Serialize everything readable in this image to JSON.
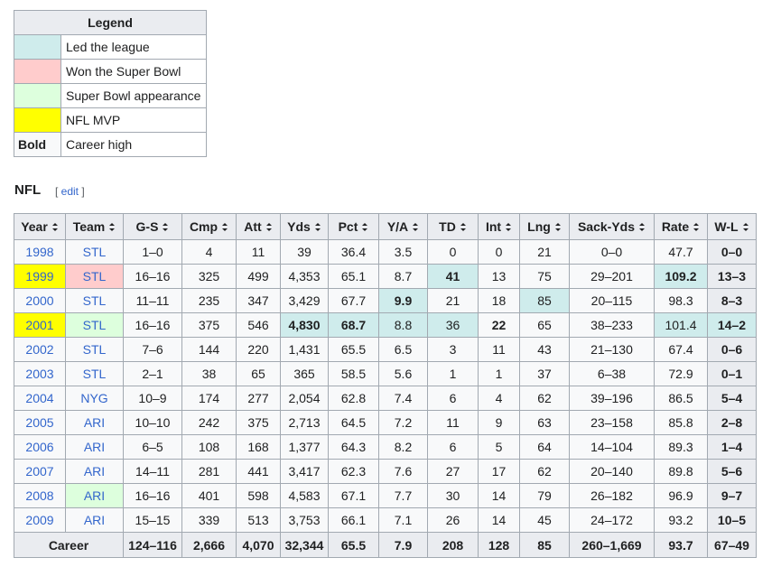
{
  "legend": {
    "title": "Legend",
    "rows": [
      {
        "key": "led",
        "color": "#cfecec",
        "label": "Led the league"
      },
      {
        "key": "won",
        "color": "#ffcccc",
        "label": "Won the Super Bowl"
      },
      {
        "key": "sb",
        "color": "#ddffdd",
        "label": "Super Bowl appearance"
      },
      {
        "key": "mvp",
        "color": "#ffff00",
        "label": "NFL MVP"
      },
      {
        "key": "bold",
        "swatch_text": "Bold",
        "label": "Career high"
      }
    ]
  },
  "section": {
    "title": "NFL",
    "edit_label": "edit",
    "bracket_open": "[ ",
    "bracket_close": " ]"
  },
  "table": {
    "columns": [
      "Year",
      "Team",
      "G-S",
      "Cmp",
      "Att",
      "Yds",
      "Pct",
      "Y/A",
      "TD",
      "Int",
      "Lng",
      "Sack-Yds",
      "Rate",
      "W-L"
    ],
    "rows": [
      {
        "year": "1998",
        "team": "STL",
        "gs": "1–0",
        "cmp": "4",
        "att": "11",
        "yds": "39",
        "pct": "36.4",
        "ya": "3.5",
        "td": "0",
        "int": "0",
        "lng": "21",
        "sack": "0–0",
        "rate": "47.7",
        "wl": "0–0"
      },
      {
        "year": "1999",
        "team": "STL",
        "gs": "16–16",
        "cmp": "325",
        "att": "499",
        "yds": "4,353",
        "pct": "65.1",
        "ya": "8.7",
        "td": "41",
        "int": "13",
        "lng": "75",
        "sack": "29–201",
        "rate": "109.2",
        "wl": "13–3"
      },
      {
        "year": "2000",
        "team": "STL",
        "gs": "11–11",
        "cmp": "235",
        "att": "347",
        "yds": "3,429",
        "pct": "67.7",
        "ya": "9.9",
        "td": "21",
        "int": "18",
        "lng": "85",
        "sack": "20–115",
        "rate": "98.3",
        "wl": "8–3"
      },
      {
        "year": "2001",
        "team": "STL",
        "gs": "16–16",
        "cmp": "375",
        "att": "546",
        "yds": "4,830",
        "pct": "68.7",
        "ya": "8.8",
        "td": "36",
        "int": "22",
        "lng": "65",
        "sack": "38–233",
        "rate": "101.4",
        "wl": "14–2"
      },
      {
        "year": "2002",
        "team": "STL",
        "gs": "7–6",
        "cmp": "144",
        "att": "220",
        "yds": "1,431",
        "pct": "65.5",
        "ya": "6.5",
        "td": "3",
        "int": "11",
        "lng": "43",
        "sack": "21–130",
        "rate": "67.4",
        "wl": "0–6"
      },
      {
        "year": "2003",
        "team": "STL",
        "gs": "2–1",
        "cmp": "38",
        "att": "65",
        "yds": "365",
        "pct": "58.5",
        "ya": "5.6",
        "td": "1",
        "int": "1",
        "lng": "37",
        "sack": "6–38",
        "rate": "72.9",
        "wl": "0–1"
      },
      {
        "year": "2004",
        "team": "NYG",
        "gs": "10–9",
        "cmp": "174",
        "att": "277",
        "yds": "2,054",
        "pct": "62.8",
        "ya": "7.4",
        "td": "6",
        "int": "4",
        "lng": "62",
        "sack": "39–196",
        "rate": "86.5",
        "wl": "5–4"
      },
      {
        "year": "2005",
        "team": "ARI",
        "gs": "10–10",
        "cmp": "242",
        "att": "375",
        "yds": "2,713",
        "pct": "64.5",
        "ya": "7.2",
        "td": "11",
        "int": "9",
        "lng": "63",
        "sack": "23–158",
        "rate": "85.8",
        "wl": "2–8"
      },
      {
        "year": "2006",
        "team": "ARI",
        "gs": "6–5",
        "cmp": "108",
        "att": "168",
        "yds": "1,377",
        "pct": "64.3",
        "ya": "8.2",
        "td": "6",
        "int": "5",
        "lng": "64",
        "sack": "14–104",
        "rate": "89.3",
        "wl": "1–4"
      },
      {
        "year": "2007",
        "team": "ARI",
        "gs": "14–11",
        "cmp": "281",
        "att": "441",
        "yds": "3,417",
        "pct": "62.3",
        "ya": "7.6",
        "td": "27",
        "int": "17",
        "lng": "62",
        "sack": "20–140",
        "rate": "89.8",
        "wl": "5–6"
      },
      {
        "year": "2008",
        "team": "ARI",
        "gs": "16–16",
        "cmp": "401",
        "att": "598",
        "yds": "4,583",
        "pct": "67.1",
        "ya": "7.7",
        "td": "30",
        "int": "14",
        "lng": "79",
        "sack": "26–182",
        "rate": "96.9",
        "wl": "9–7"
      },
      {
        "year": "2009",
        "team": "ARI",
        "gs": "15–15",
        "cmp": "339",
        "att": "513",
        "yds": "3,753",
        "pct": "66.1",
        "ya": "7.1",
        "td": "26",
        "int": "14",
        "lng": "45",
        "sack": "24–172",
        "rate": "93.2",
        "wl": "10–5"
      }
    ],
    "career": {
      "label": "Career",
      "gs": "124–116",
      "cmp": "2,666",
      "att": "4,070",
      "yds": "32,344",
      "pct": "65.5",
      "ya": "7.9",
      "td": "208",
      "int": "128",
      "lng": "85",
      "sack": "260–1,669",
      "rate": "93.7",
      "wl": "67–49"
    }
  }
}
